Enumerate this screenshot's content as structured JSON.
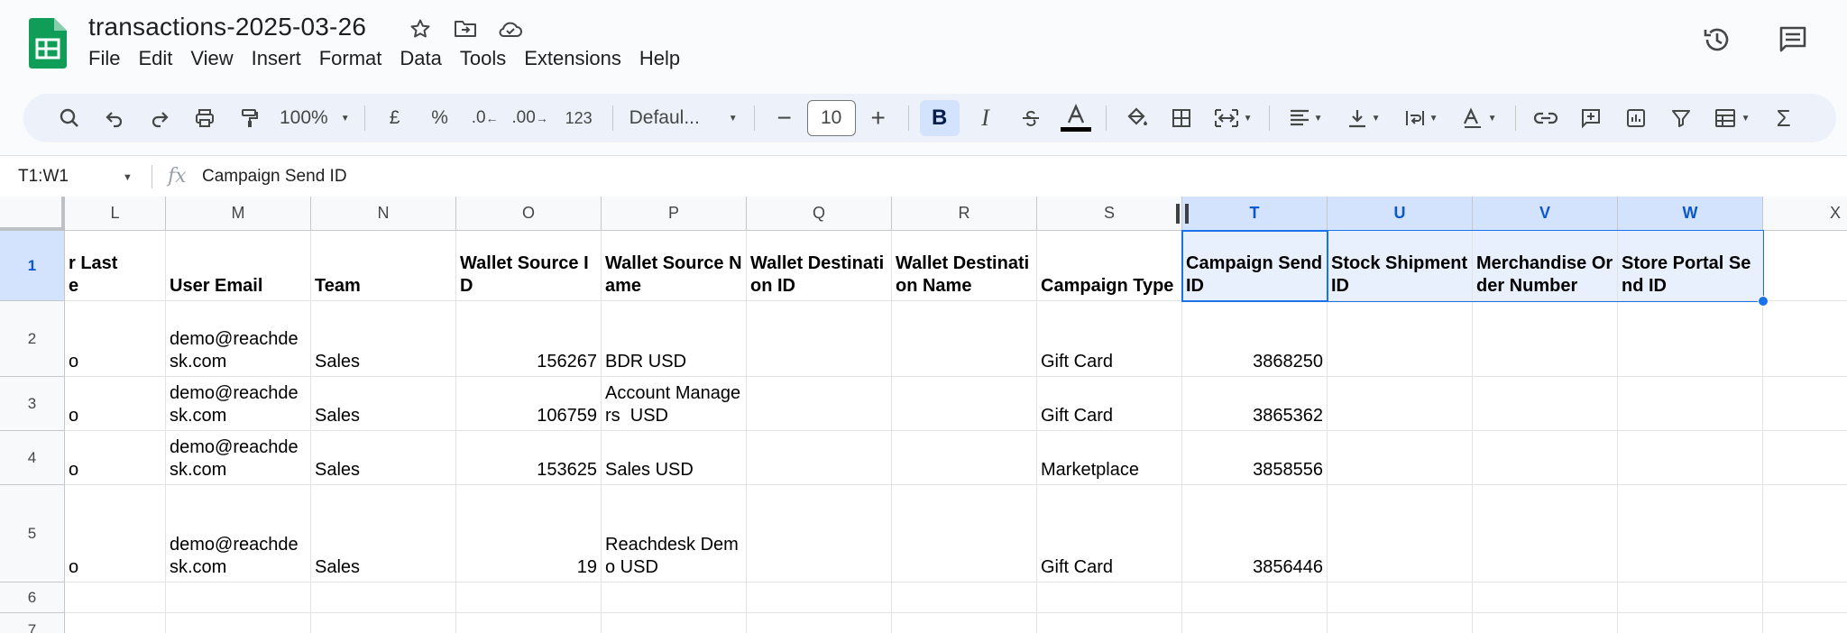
{
  "doc": {
    "title": "transactions-2025-03-26"
  },
  "menu": [
    "File",
    "Edit",
    "View",
    "Insert",
    "Format",
    "Data",
    "Tools",
    "Extensions",
    "Help"
  ],
  "toolbar": {
    "zoom": "100%",
    "currency": "£",
    "percent": "%",
    "dec_less": ".0",
    "dec_more": ".00",
    "number_format": "123",
    "font": "Defaul...",
    "font_size": "10",
    "bold": "B",
    "italic": "I"
  },
  "formula_bar": {
    "name_box": "T1:W1",
    "fx": "fx",
    "formula": "Campaign Send ID"
  },
  "columns": [
    "L",
    "M",
    "N",
    "O",
    "P",
    "Q",
    "R",
    "S",
    "T",
    "U",
    "V",
    "W",
    "X"
  ],
  "rows": [
    "1",
    "2",
    "3",
    "4",
    "5",
    "6",
    "7"
  ],
  "headers": {
    "L": "r Last\ne",
    "M": "User Email",
    "N": "Team",
    "O": "Wallet Source ID",
    "P": "Wallet Source Name",
    "Q": "Wallet Destination ID",
    "R": "Wallet Destination Name",
    "S": "Campaign Type",
    "T": "Campaign Send ID",
    "U": "Stock Shipment ID",
    "V": "Merchandise Order Number",
    "W": "Store Portal Send ID"
  },
  "data_rows": [
    {
      "L": "o",
      "M": "demo@reachdesk.com",
      "N": "Sales",
      "O": "156267",
      "P": "BDR USD",
      "Q": "",
      "R": "",
      "S": "Gift Card",
      "T": "3868250"
    },
    {
      "L": "o",
      "M": "demo@reachdesk.com",
      "N": "Sales",
      "O": "106759",
      "P": "Account Managers  USD",
      "Q": "",
      "R": "",
      "S": "Gift Card",
      "T": "3865362"
    },
    {
      "L": "o",
      "M": "demo@reachdesk.com",
      "N": "Sales",
      "O": "153625",
      "P": "Sales USD",
      "Q": "",
      "R": "",
      "S": "Marketplace",
      "T": "3858556"
    },
    {
      "L": "o",
      "M": "demo@reachdesk.com",
      "N": "Sales",
      "O": "19",
      "P": "Reachdesk Demo USD",
      "Q": "",
      "R": "",
      "S": "Gift Card",
      "T": "3856446"
    }
  ],
  "colors": {
    "accent": "#1a73e8",
    "selection_fill": "#e8f0fe",
    "header_selected": "#d3e3fd",
    "logo_green": "#0f9d58"
  }
}
